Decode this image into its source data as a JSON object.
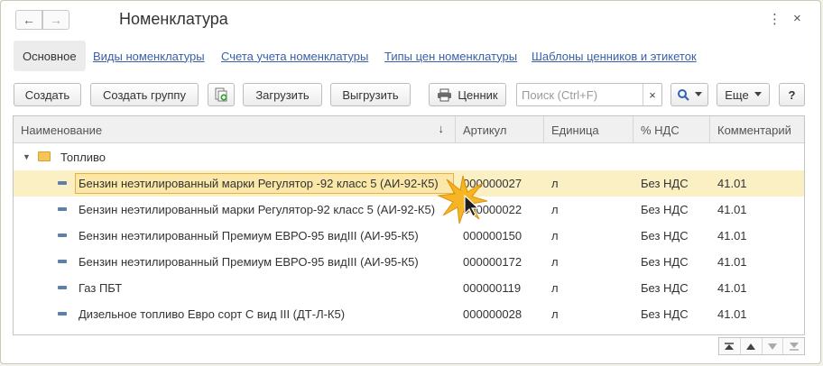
{
  "window": {
    "title": "Номенклатура",
    "more_icon": "⋮",
    "close_icon": "×",
    "back_icon": "←",
    "forward_icon": "→"
  },
  "tabs": [
    {
      "label": "Основное",
      "active": true
    },
    {
      "label": "Виды номенклатуры"
    },
    {
      "label": "Счета учета номенклатуры"
    },
    {
      "label": "Типы цен номенклатуры"
    },
    {
      "label": "Шаблоны ценников и этикеток"
    }
  ],
  "toolbar": {
    "create_label": "Создать",
    "create_group_label": "Создать группу",
    "load_label": "Загрузить",
    "unload_label": "Выгрузить",
    "price_tag_label": "Ценник",
    "search_placeholder": "Поиск (Ctrl+F)",
    "search_clear_icon": "×",
    "more_label": "Еще",
    "help_label": "?"
  },
  "table": {
    "columns": [
      "Наименование",
      "Артикул",
      "Единица",
      "% НДС",
      "Комментарий"
    ],
    "sort_indicator": "↓",
    "group": {
      "name": "Топливо",
      "expanded": true
    },
    "rows": [
      {
        "name": "Бензин неэтилированный марки Регулятор -92 класс 5 (АИ-92-К5)",
        "article": "000000027",
        "unit": "л",
        "vat": "Без НДС",
        "comment": "41.01",
        "selected": true
      },
      {
        "name": "Бензин неэтилированный марки Регулятор-92 класс 5 (АИ-92-К5)",
        "article": "000000022",
        "unit": "л",
        "vat": "Без НДС",
        "comment": "41.01"
      },
      {
        "name": "Бензин неэтилированный Премиум ЕВРО-95 видIII (АИ-95-К5)",
        "article": "000000150",
        "unit": "л",
        "vat": "Без НДС",
        "comment": "41.01"
      },
      {
        "name": "Бензин неэтилированный Премиум ЕВРО-95 видIII (АИ-95-К5)",
        "article": "000000172",
        "unit": "л",
        "vat": "Без НДС",
        "comment": "41.01"
      },
      {
        "name": "Газ ПБТ",
        "article": "000000119",
        "unit": "л",
        "vat": "Без НДС",
        "comment": "41.01"
      },
      {
        "name": "Дизельное топливо Евро сорт С вид III (ДТ-Л-К5)",
        "article": "000000028",
        "unit": "л",
        "vat": "Без НДС",
        "comment": "41.01"
      }
    ]
  },
  "icons": {
    "add_copy": "copy-add-icon",
    "printer": "printer-icon",
    "search": "search-icon",
    "folder": "folder-icon",
    "item": "item-icon"
  },
  "colors": {
    "selected_row": "#fbf0c4",
    "focus_cell": "#fbe7a8",
    "link": "#3a5fa8",
    "active_tab_bg": "#ececec"
  }
}
